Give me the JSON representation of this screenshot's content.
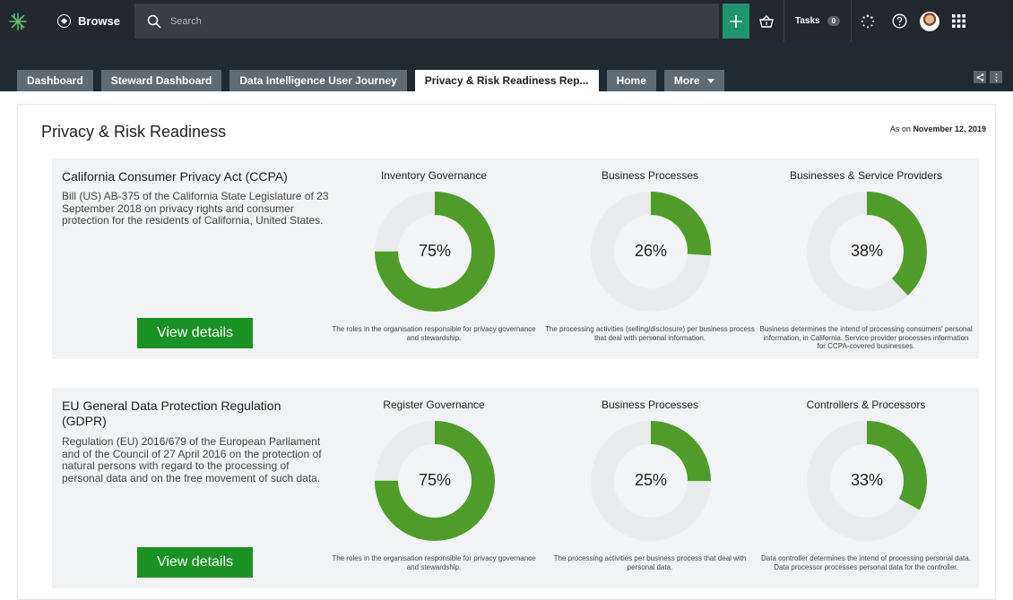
{
  "topbar": {
    "browse_label": "Browse",
    "search_placeholder": "Search",
    "tasks_label": "Tasks",
    "tasks_count": "0"
  },
  "tabs": [
    {
      "label": "Dashboard"
    },
    {
      "label": "Steward Dashboard"
    },
    {
      "label": "Data Intelligence User Journey"
    },
    {
      "label": "Privacy & Risk Readiness Rep..."
    },
    {
      "label": "Home"
    },
    {
      "label": "More"
    }
  ],
  "page": {
    "title": "Privacy & Risk Readiness",
    "as_on_prefix": "As on",
    "as_on_date": "November 12, 2019"
  },
  "colors": {
    "topbar": "#22282d",
    "tabstrip": "#202a33",
    "accent_green": "#21946d",
    "donut_green": "#4f9c2b",
    "donut_track": "#e9ebed",
    "button_green": "#1b9124"
  },
  "regulations": [
    {
      "title": "California Consumer Privacy Act (CCPA)",
      "description": "Bill (US) AB-375 of the California State Legislature of 23 September 2018 on privacy rights and consumer protection for the residents of California, United States.",
      "button_label": "View details",
      "metrics": [
        {
          "title": "Inventory Governance",
          "label": "75%",
          "percent": 75,
          "caption": "The roles in the organisation responsible for privacy governance and stewardship."
        },
        {
          "title": "Business Processes",
          "label": "26%",
          "percent": 26,
          "caption": "The processing activities (selling/disclosure) per business process that deal with personal information."
        },
        {
          "title": "Businesses & Service Providers",
          "label": "38%",
          "percent": 38,
          "caption": "Business determines the intend of processing consumers' personal information, in California. Service provider processes information for CCPA-covered businesses."
        }
      ]
    },
    {
      "title": "EU General Data Protection Regulation (GDPR)",
      "description": "Regulation (EU) 2016/679 of the European Parliament and of the Council of 27 April 2016 on the protection of natural persons with regard to the processing of personal data and on the free movement of such data.",
      "button_label": "View details",
      "metrics": [
        {
          "title": "Register Governance",
          "label": "75%",
          "percent": 75,
          "caption": "The roles in the organisation responsible for privacy governance and stewardship."
        },
        {
          "title": "Business Processes",
          "label": "25%",
          "percent": 25,
          "caption": "The processing activities per business process that deal with personal data."
        },
        {
          "title": "Controllers & Processors",
          "label": "33%",
          "percent": 33,
          "caption": "Data controller determines the intend of processing personal data. Data processor processes personal data for the controller."
        }
      ]
    }
  ]
}
